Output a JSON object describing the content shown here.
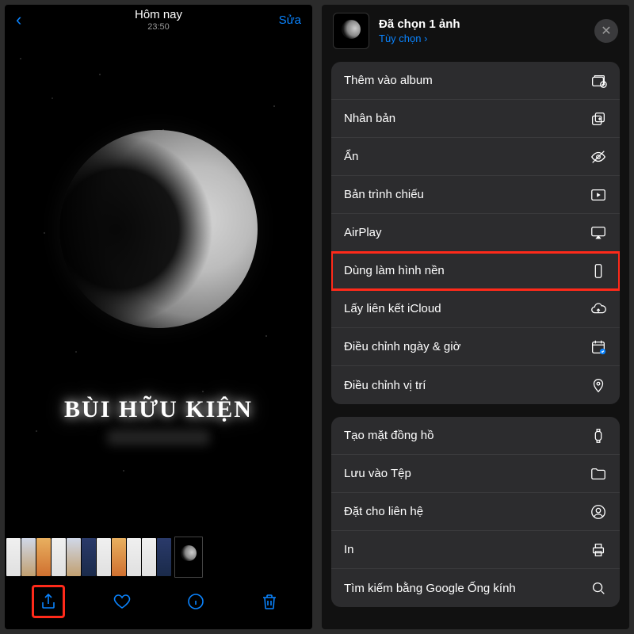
{
  "left": {
    "header": {
      "title": "Hôm nay",
      "time": "23:50",
      "edit": "Sửa"
    },
    "photo_caption": "BÙI HỮU KIỆN"
  },
  "right": {
    "header": {
      "title": "Đã chọn 1 ảnh",
      "options": "Tùy chọn ›"
    },
    "group1": {
      "add_album": "Thêm vào album",
      "duplicate": "Nhân bản",
      "hide": "Ẩn",
      "slideshow": "Bản trình chiếu",
      "airplay": "AirPlay",
      "wallpaper": "Dùng làm hình nền",
      "icloud_link": "Lấy liên kết iCloud",
      "adjust_date": "Điều chỉnh ngày & giờ",
      "adjust_loc": "Điều chỉnh vị trí"
    },
    "group2": {
      "watch_face": "Tạo mặt đồng hồ",
      "save_files": "Lưu vào Tệp",
      "assign_contact": "Đặt cho liên hệ",
      "print": "In",
      "google_lens": "Tìm kiếm bằng Google Ống kính"
    }
  }
}
